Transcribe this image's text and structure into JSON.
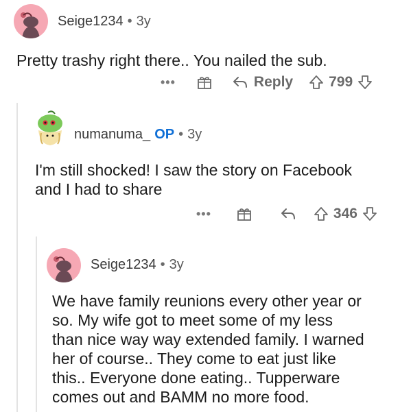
{
  "comments": [
    {
      "username": "Seige1234",
      "is_op": false,
      "age": "3y",
      "body": "Pretty trashy right there.. You nailed the sub.",
      "reply_label": "Reply",
      "votes": "799"
    },
    {
      "username": "numanuma_",
      "is_op": true,
      "op_label": "OP",
      "age": "3y",
      "body_lines": [
        "I'm still shocked! I saw the story on Facebook",
        "and I had to share"
      ],
      "votes": "346"
    },
    {
      "username": "Seige1234",
      "is_op": false,
      "age": "3y",
      "body_lines": [
        "We have family reunions every other year or",
        "so.  My wife got to meet some of my less",
        "than nice way way extended family. I warned",
        "her of course.. They come to eat just like",
        "this.. Everyone done eating.. Tupperware",
        "comes out and BAMM no more food."
      ]
    }
  ],
  "separator": "•",
  "more_label": "•••",
  "colors": {
    "op": "#0f6fd6",
    "avatar_pink": "#f6a8b4",
    "thread_line": "#e3e3e3"
  }
}
